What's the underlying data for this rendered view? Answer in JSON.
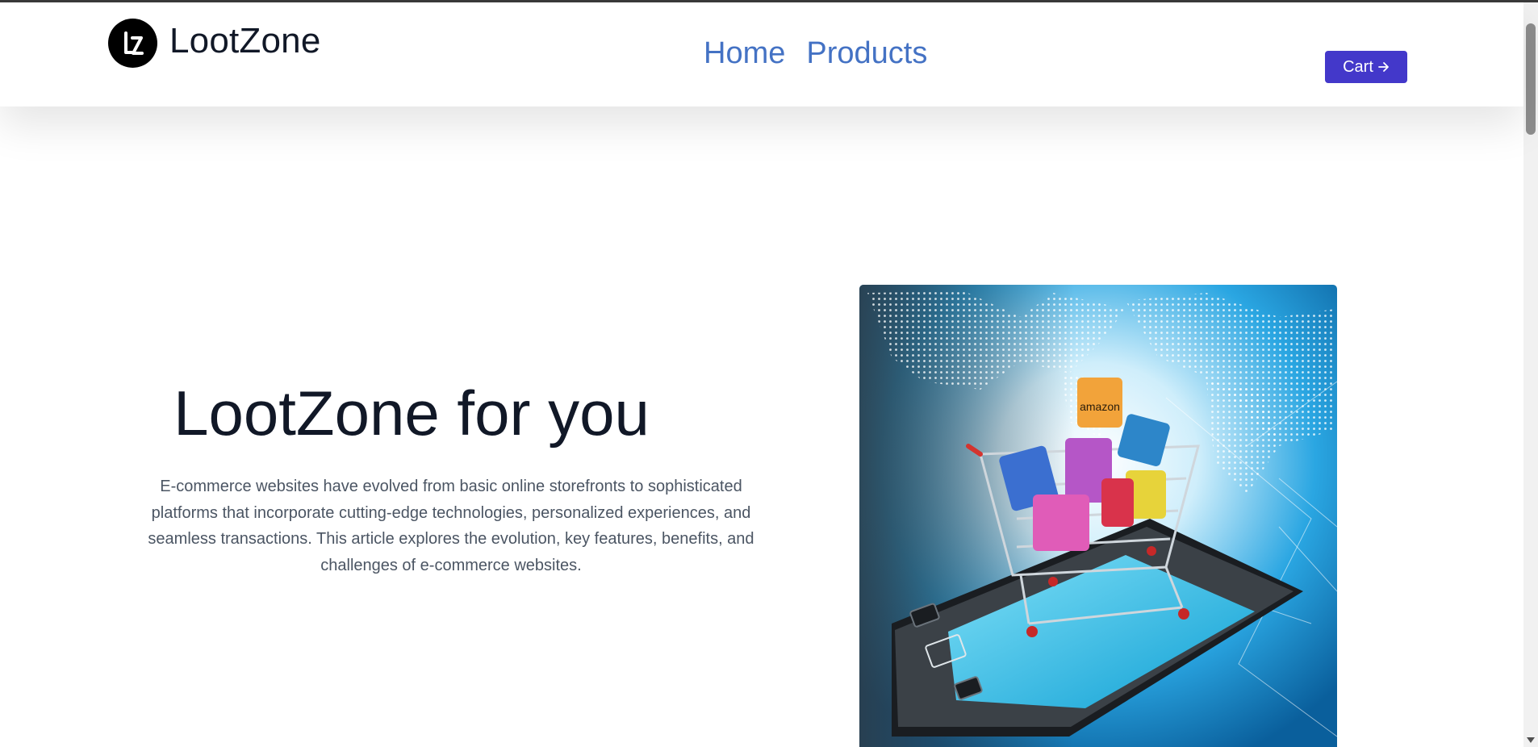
{
  "brand": {
    "name": "LootZone",
    "logo_icon": "lz-monogram-logo"
  },
  "nav": {
    "home": "Home",
    "products": "Products"
  },
  "cart": {
    "label": "Cart",
    "icon": "arrow-right-icon"
  },
  "hero": {
    "title": "LootZone for you",
    "text": "E-commerce websites have evolved from basic online storefronts to sophisticated platforms that incorporate cutting-edge technologies, personalized experiences, and seamless transactions. This article explores the evolution, key features, benefits, and challenges of e-commerce websites.",
    "image_label": "amazon",
    "image_subject": "shopping-cart-on-smartphone-illustration"
  },
  "colors": {
    "accent": "#4338ca",
    "nav_link": "#4472c4",
    "heading": "#111827",
    "body_text": "#4b5563"
  }
}
